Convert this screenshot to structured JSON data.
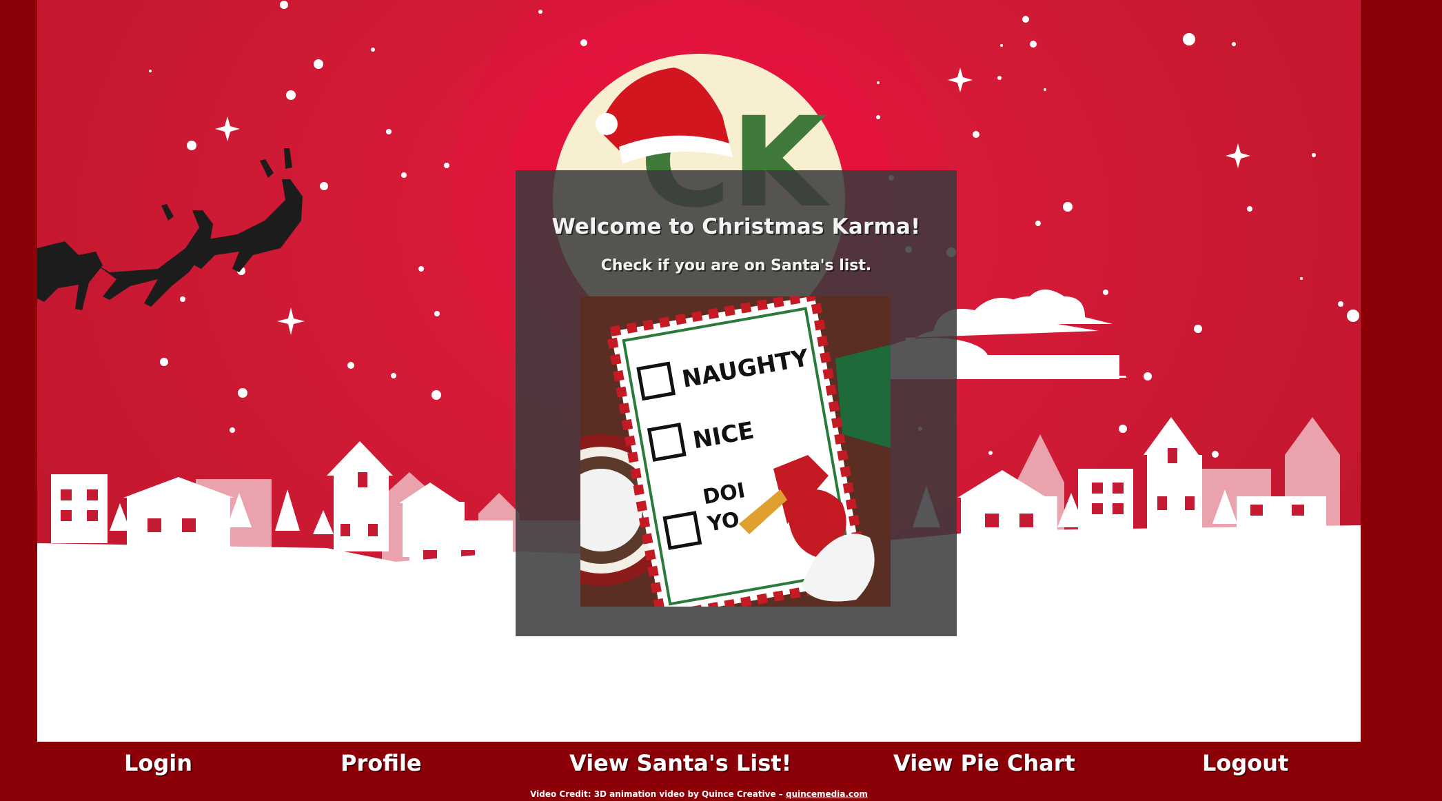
{
  "logo": {
    "text": "CK"
  },
  "welcome": {
    "title": "Welcome to Christmas Karma!",
    "subtitle": "Check if you are on Santa's list."
  },
  "checklist": {
    "items": [
      "NAUGHTY",
      "NICE",
      "DOI",
      "YO"
    ]
  },
  "nav": {
    "login": "Login",
    "profile": "Profile",
    "santas_list": "View Santa's List!",
    "pie_chart": "View Pie Chart",
    "logout": "Logout"
  },
  "credit": {
    "text": "Video Credit: 3D animation video by Quince Creative –",
    "link": "quincemedia.com"
  },
  "colors": {
    "page_border": "#8c0008",
    "sky": "#d21a36",
    "card_overlay": "#3a3a3c",
    "logo_green": "#3f7a3a",
    "moon": "#f7efcf"
  }
}
